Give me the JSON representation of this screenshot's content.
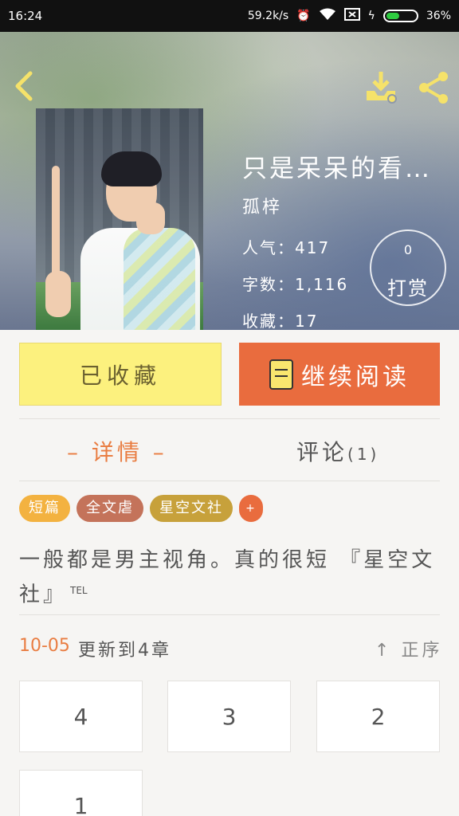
{
  "statusbar": {
    "time": "16:24",
    "speed": "59.2k/s",
    "battery": "36%"
  },
  "header": {
    "back_icon": "chevron-left-icon",
    "download_icon": "download-icon",
    "share_icon": "share-icon"
  },
  "book": {
    "title": "只是呆呆的看…",
    "author": "孤梓",
    "popularity": "人气：417",
    "word_count": "字数：1,116",
    "favorites": "收藏：17",
    "reward_count": "0",
    "reward_label": "打赏"
  },
  "actions": {
    "collected_label": "已收藏",
    "read_label": "继续阅读"
  },
  "tabs": {
    "details": "– 详情 –",
    "comments": "评论",
    "comments_count": "(1)"
  },
  "tags": [
    "短篇",
    "全文虐",
    "星空文社",
    "+"
  ],
  "summary": {
    "text": "一般都是男主视角。真的很短 『星空文社』",
    "sup": "TEL"
  },
  "update": {
    "date": "10-05",
    "text": "更新到4章",
    "sort_label": "正序"
  },
  "chapters": [
    "4",
    "3",
    "2",
    "1"
  ],
  "colors": {
    "accent": "#e96c3e",
    "collected_bg": "#fcf17e",
    "tag_orange": "#f3b240",
    "tag_brown": "#c4735a",
    "tag_gold": "#c7a13b"
  }
}
